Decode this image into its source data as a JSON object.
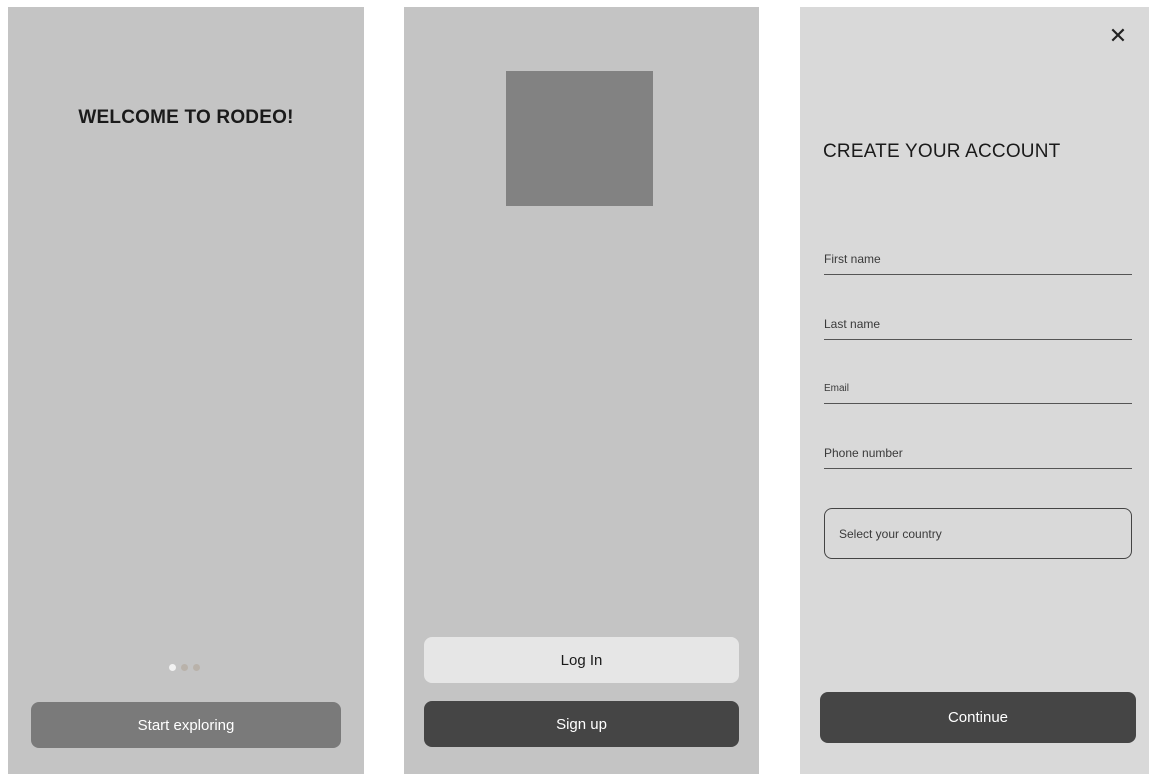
{
  "welcome": {
    "title": "WELCOME TO RODEO!",
    "pager": {
      "count": 3,
      "active_index": 0
    },
    "cta_label": "Start exploring"
  },
  "auth": {
    "image_placeholder": "image-placeholder",
    "login_label": "Log In",
    "signup_label": "Sign up"
  },
  "signup": {
    "close_icon": "close-icon",
    "close_glyph": "✕",
    "title": "CREATE YOUR ACCOUNT",
    "fields": {
      "first_name": {
        "placeholder": "First name",
        "value": ""
      },
      "last_name": {
        "placeholder": "Last name",
        "value": ""
      },
      "email": {
        "placeholder": "Email",
        "value": ""
      },
      "phone": {
        "placeholder": "Phone number",
        "value": ""
      }
    },
    "country_select": {
      "placeholder": "Select your country"
    },
    "continue_label": "Continue"
  },
  "colors": {
    "screen_bg": "#c4c4c4",
    "signup_bg": "#d9d9d9",
    "dark_button": "#454545",
    "muted_button": "#7a7a7a",
    "light_button": "#e6e6e6"
  }
}
